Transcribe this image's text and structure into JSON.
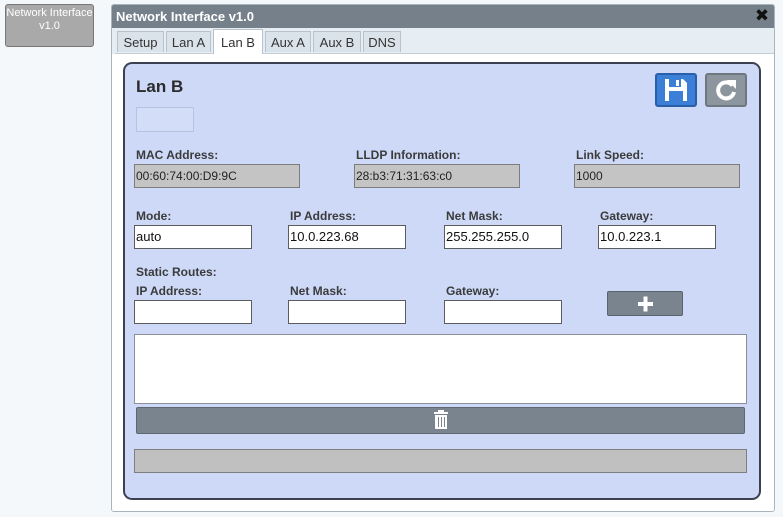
{
  "desktop": {
    "icon_label": "Network Interface v1.0"
  },
  "window": {
    "title": "Network Interface v1.0",
    "close_glyph": "✖"
  },
  "tabs": [
    {
      "label": "Setup"
    },
    {
      "label": "Lan A"
    },
    {
      "label": "Lan B"
    },
    {
      "label": "Aux A"
    },
    {
      "label": "Aux B"
    },
    {
      "label": "DNS"
    }
  ],
  "active_tab": "Lan B",
  "panel": {
    "title": "Lan B",
    "mac": {
      "label": "MAC Address:",
      "value": "00:60:74:00:D9:9C"
    },
    "lldp": {
      "label": "LLDP Information:",
      "value": "28:b3:71:31:63:c0"
    },
    "link_speed": {
      "label": "Link Speed:",
      "value": "1000"
    },
    "mode": {
      "label": "Mode:",
      "value": "auto"
    },
    "ip_address": {
      "label": "IP Address:",
      "value": "10.0.223.68"
    },
    "net_mask": {
      "label": "Net Mask:",
      "value": "255.255.255.0"
    },
    "gateway": {
      "label": "Gateway:",
      "value": "10.0.223.1"
    },
    "static_routes": {
      "heading": "Static Routes:",
      "ip_label": "IP Address:",
      "mask_label": "Net Mask:",
      "gateway_label": "Gateway:",
      "ip_value": "",
      "mask_value": "",
      "gateway_value": ""
    }
  },
  "icons": {
    "save": "floppy-disk-icon",
    "refresh": "refresh-icon",
    "add": "plus-icon",
    "delete": "trash-icon"
  },
  "colors": {
    "titlebar": "#75808b",
    "panel_bg": "#cdd9f7",
    "save_button": "#3b7fd6",
    "refresh_button": "#8d969e"
  }
}
